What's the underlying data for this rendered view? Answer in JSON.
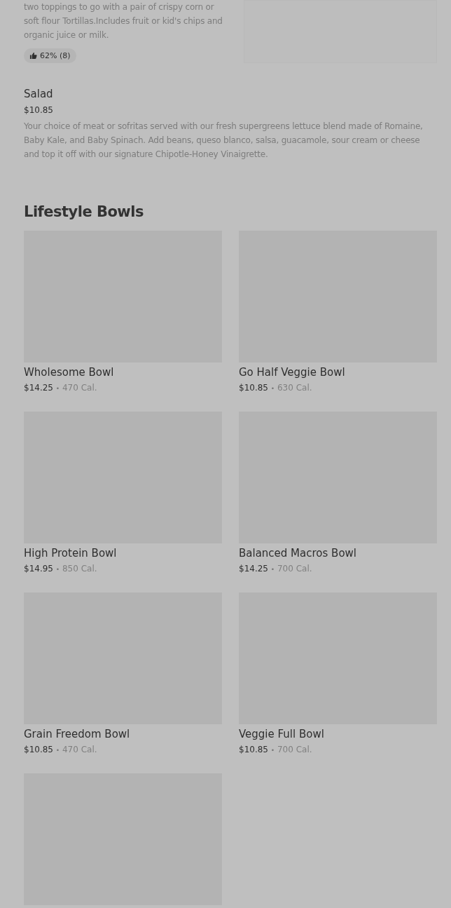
{
  "top_item": {
    "description": "two toppings to go with a pair of crispy corn or soft flour Tortillas.Includes fruit or kid's chips and organic juice or milk.",
    "rating": "62% (8)"
  },
  "salad": {
    "name": "Salad",
    "price": "$10.85",
    "description": "Your choice of meat or sofritas served with our fresh supergreens lettuce blend made of Romaine, Baby Kale, and Baby Spinach. Add beans, queso blanco, salsa, guacamole, sour cream or cheese and top it off with our signature Chipotle-Honey Vinaigrette."
  },
  "section": {
    "title": "Lifestyle Bowls"
  },
  "bowls": [
    {
      "kind": "full",
      "name": "Wholesome Bowl",
      "price": "$14.25",
      "separator": "•",
      "calories": "470 Cal."
    },
    {
      "kind": "full",
      "name": "Go Half Veggie Bowl",
      "price": "$10.85",
      "separator": "•",
      "calories": "630 Cal."
    },
    {
      "kind": "full",
      "name": "High Protein Bowl",
      "price": "$14.95",
      "separator": "•",
      "calories": "850 Cal."
    },
    {
      "kind": "full",
      "name": "Balanced Macros Bowl",
      "price": "$14.25",
      "separator": "•",
      "calories": "700 Cal."
    },
    {
      "kind": "full",
      "name": "Grain Freedom Bowl",
      "price": "$10.85",
      "separator": "•",
      "calories": "470 Cal."
    },
    {
      "kind": "full",
      "name": "Veggie Full Bowl",
      "price": "$10.85",
      "separator": "•",
      "calories": "700 Cal."
    },
    {
      "kind": "image_only"
    }
  ]
}
